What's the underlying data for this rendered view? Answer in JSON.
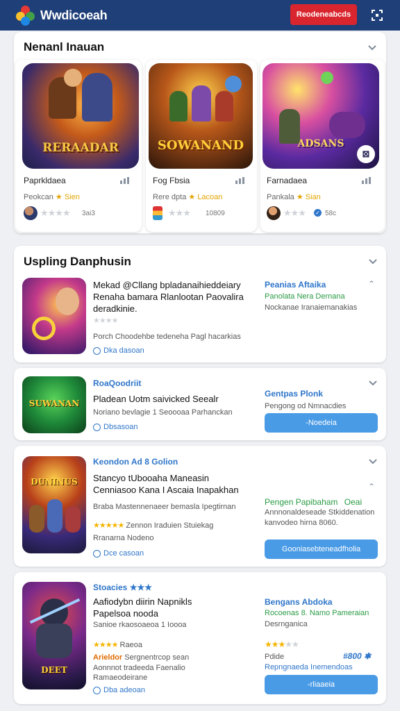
{
  "header": {
    "brand": "Wwdicoeah",
    "cta": "Reodeneabcds"
  },
  "featured": {
    "title": "Nenanl Inauan",
    "tiles": [
      {
        "art": "RERAADAR",
        "name": "Paprkldaea",
        "sub": "Peokcan",
        "sub_gold": "Sien",
        "small": "3ai3"
      },
      {
        "art": "SOWANAND",
        "name": "Fog Fbsia",
        "sub": "Rere dpta",
        "sub_gold": "Lacoan",
        "small": "10809"
      },
      {
        "art": "ADSANS",
        "name": "Farnadaea",
        "sub": "Pankala",
        "sub_gold": "Sian",
        "small": "58c"
      }
    ]
  },
  "upcoming": {
    "title": "Uspling Danphusin",
    "rows": [
      {
        "title_lines": [
          "Mekad @Cllang bpladanaihieddeiary",
          "Renaha bamara Rlanlootan Paovalira",
          "deradkinie."
        ],
        "rating_text": "Porch Choodehbe tedeneha Pagl hacarkias",
        "link": "Dka dasoan",
        "right_blue": "Peanias Aftaika",
        "right_green": "Panolata Nera Dernana",
        "right_gray": "Nockanae Iranaiemanakias"
      },
      {
        "blue_title": "RoaQoodriit",
        "title_lines": [
          "Pladean Uotm saivicked Seealr"
        ],
        "sub": "Noriano bevlagie 1 Seoooaa Parhanckan",
        "link": "Dbsasoan",
        "right_blue": "Gentpas Plonk",
        "right_gray": "Pengong od Nmnacdies",
        "button": "-Noedeia"
      },
      {
        "blue_title": "Keondon Ad 8 Golion",
        "title_lines": [
          "Stancyo tUbooaha Maneasin",
          "Cenniasoo Kana I Ascaia Inapakhan"
        ],
        "sub": "Braba Mastennenaeer bemasla Ipegtirnan",
        "rating_text": "Zennon Iraduien Stuiekag",
        "sub2": "Rranarna Nodeno",
        "link": "Dce casoan",
        "right_green": "Pengen Papibaham",
        "right_green2": "Oeai",
        "right_gray": "Annnonaldeseade Stkiddenation kanvodeo hirna 8060.",
        "button": "Gooniasebteneadfholia"
      },
      {
        "blue_title": "Stoacies",
        "title_lines": [
          "Aafiodybn diirin Napnikls",
          "Papelsoa nooda"
        ],
        "sub": "Sanioe rkaosoaeoa 1 Ioooa",
        "rating_text": "Raeoa",
        "sub_orange": "Arieldor",
        "sub_tail": "Sergnentrcop sean",
        "sub2": "Aonnnot tradeeda Faenalio",
        "sub3": "Ramaeodeirane",
        "link": "Dba adeoan",
        "right_blue": "Bengans Abdoka",
        "right_green": "Rocoenas 8. Namo Pameraian",
        "right_gray": "Desrnganica",
        "right_price_label": "Pdide",
        "right_price": "#800",
        "right_green2": "Repngnaeda Inemendoas",
        "button": "-rliaaeia"
      }
    ]
  },
  "colors": {
    "header": "#1f3f78",
    "cta": "#d9262e",
    "accent_blue": "#2f76c9",
    "button_blue": "#4a9be6",
    "star": "#f5b400"
  }
}
